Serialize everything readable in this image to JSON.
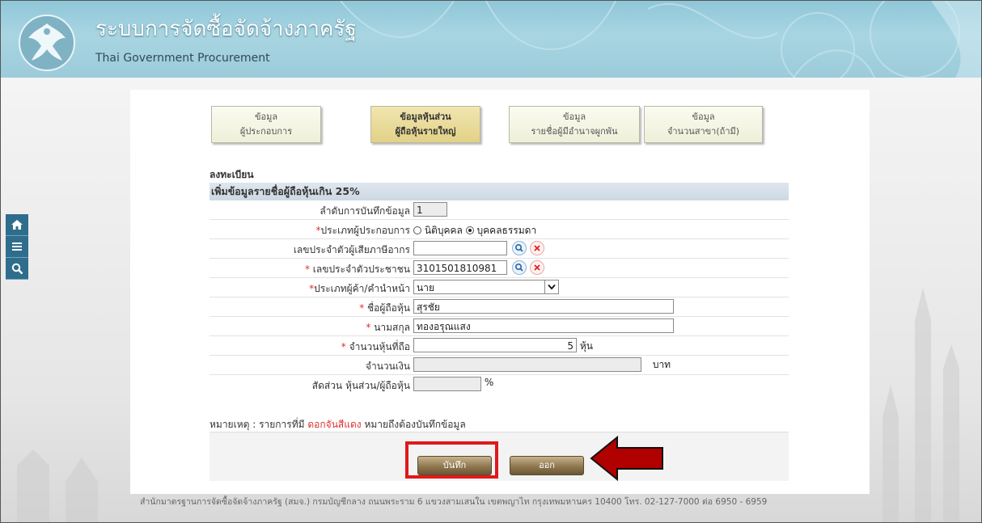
{
  "app": {
    "title": "ระบบการจัดซื้อจัดจ้างภาครัฐ",
    "subtitle": "Thai Government Procurement"
  },
  "side_nav": [
    {
      "icon": "home-icon"
    },
    {
      "icon": "menu-icon"
    },
    {
      "icon": "search-icon"
    }
  ],
  "tabs": [
    {
      "line1": "ข้อมูล",
      "line2": "ผู้ประกอบการ",
      "active": false
    },
    {
      "line1": "ข้อมูลหุ้นส่วน",
      "line2": "ผู้ถือหุ้นรายใหญ่",
      "active": true
    },
    {
      "line1": "ข้อมูล",
      "line2": "รายชื่อผู้มีอำนาจผูกพัน",
      "active": false
    },
    {
      "line1": "ข้อมูล",
      "line2": "จำนวนสาขา(ถ้ามี)",
      "active": false
    }
  ],
  "section_label": "ลงทะเบียน",
  "form": {
    "title": "เพิ่มข้อมูลรายชื่อผู้ถือหุ้นเกิน 25%",
    "record_order": {
      "label": "ลำดับการบันทึกข้อมูล",
      "value": "1"
    },
    "operator_type": {
      "label": "ประเภทผู้ประกอบการ",
      "option_juristic": "นิติบุคคล",
      "option_natural": "บุคคลธรรมดา",
      "selected": "บุคคลธรรมดา"
    },
    "tax_id": {
      "label": "เลขประจำตัวผู้เสียภาษีอากร",
      "value": ""
    },
    "citizen_id": {
      "label": "เลขประจำตัวประชาชน",
      "value": "3101501810981"
    },
    "title_type": {
      "label": "ประเภทผู้ค้า/คำนำหน้า",
      "value": "นาย"
    },
    "first_name": {
      "label": "ชื่อผู้ถือหุ้น",
      "value": "สุรชัย"
    },
    "last_name": {
      "label": "นามสกุล",
      "value": "ทองอรุณแสง"
    },
    "shares": {
      "label": "จำนวนหุ้นที่ถือ",
      "value": "5",
      "unit": "หุ้น"
    },
    "amount": {
      "label": "จำนวนเงิน",
      "value": "",
      "unit": "บาท"
    },
    "ratio": {
      "label": "สัดส่วน หุ้นส่วน/ผู้ถือหุ้น",
      "value": "",
      "unit": "%"
    }
  },
  "note": {
    "prefix": "หมายเหตุ : รายการที่มี",
    "red": "ดอกจันสีแดง",
    "suffix": "หมายถึงต้องบันทึกข้อมูล"
  },
  "buttons": {
    "save": "บันทึก",
    "exit": "ออก"
  },
  "footer": "สำนักมาตรฐานการจัดซื้อจัดจ้างภาครัฐ (สมจ.) กรมบัญชีกลาง ถนนพระราม 6 แขวงสามเสนใน เขตพญาไท กรุงเทพมหานคร 10400 โทร. 02-127-7000 ต่อ 6950 - 6959",
  "colors": {
    "header": "#9ccbd9",
    "nav": "#2f6d8c",
    "required": "#e03030",
    "highlight": "#e0191a",
    "arrow": "#b00000"
  }
}
